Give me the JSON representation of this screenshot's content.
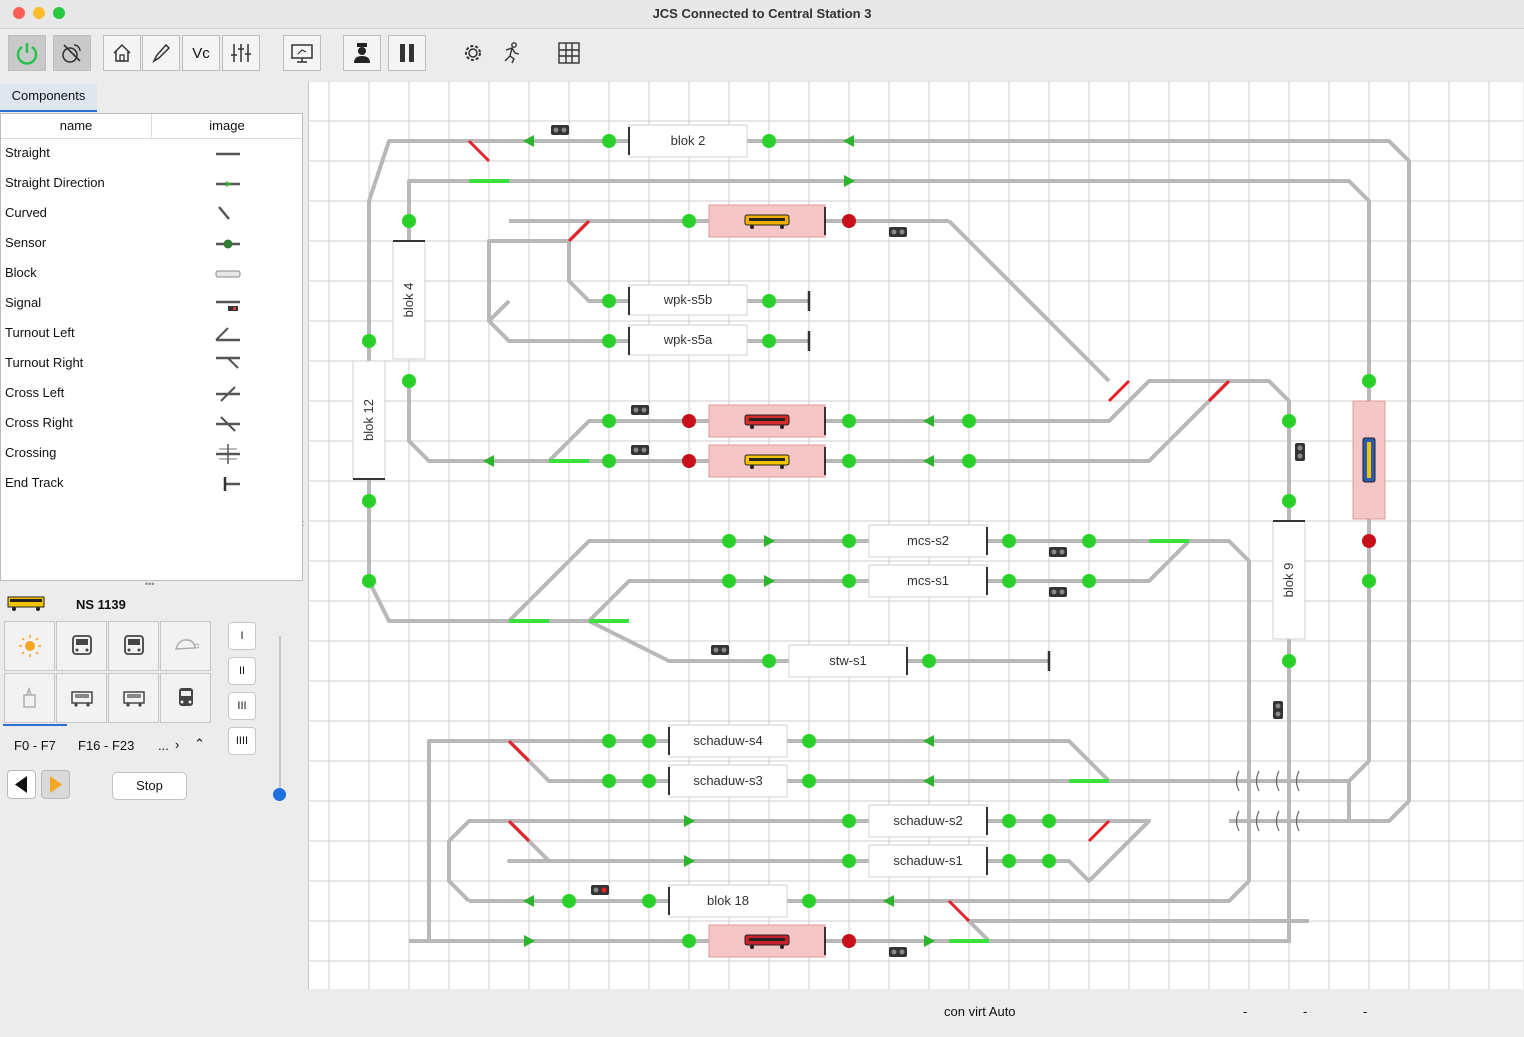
{
  "window": {
    "title": "JCS Connected to Central Station 3"
  },
  "toolbar": {
    "buttons": [
      {
        "name": "power-icon",
        "on": true
      },
      {
        "name": "connect-icon",
        "on": true
      },
      {
        "name": "home-icon"
      },
      {
        "name": "edit-icon"
      },
      {
        "name": "vc-icon",
        "label": "Vc"
      },
      {
        "name": "settings-sliders-icon"
      },
      {
        "name": "monitor-icon"
      },
      {
        "name": "driver-icon"
      },
      {
        "name": "pause-icon"
      },
      {
        "name": "gear-icon"
      },
      {
        "name": "run-icon"
      },
      {
        "name": "grid-icon"
      }
    ]
  },
  "components": {
    "tab": "Components",
    "col_name": "name",
    "col_image": "image",
    "items": [
      {
        "label": "Straight",
        "icon": "straight-icon"
      },
      {
        "label": "Straight Direction",
        "icon": "straight-direction-icon"
      },
      {
        "label": "Curved",
        "icon": "curved-icon"
      },
      {
        "label": "Sensor",
        "icon": "sensor-icon"
      },
      {
        "label": "Block",
        "icon": "block-icon"
      },
      {
        "label": "Signal",
        "icon": "signal-icon"
      },
      {
        "label": "Turnout Left",
        "icon": "turnout-left-icon"
      },
      {
        "label": "Turnout Right",
        "icon": "turnout-right-icon"
      },
      {
        "label": "Cross Left",
        "icon": "cross-left-icon"
      },
      {
        "label": "Cross Right",
        "icon": "cross-right-icon"
      },
      {
        "label": "Crossing",
        "icon": "crossing-icon"
      },
      {
        "label": "End Track",
        "icon": "end-track-icon"
      }
    ]
  },
  "loco": {
    "name": "NS 1139",
    "functions": [
      "light-icon",
      "loco-front-icon",
      "loco-rear-icon",
      "turtle-icon",
      "horn-icon",
      "coupler-icon",
      "coupler-rear-icon",
      "cab-icon"
    ],
    "speed_steps": [
      "I",
      "II",
      "III",
      "IIII"
    ],
    "tab_a": "F0 - F7",
    "tab_b": "F16 - F23",
    "tab_more": "...",
    "stop": "Stop"
  },
  "layout": {
    "blocks": [
      "blok 2",
      "wpk-s5b",
      "wpk-s5a",
      "mcs-s2",
      "mcs-s1",
      "stw-s1",
      "schaduw-s4",
      "schaduw-s3",
      "schaduw-s2",
      "schaduw-s1",
      "blok 18",
      "blok 4",
      "blok 12",
      "blok 9"
    ]
  },
  "status": {
    "text": "con virt Auto",
    "d1": "-",
    "d2": "-",
    "d3": "-"
  }
}
